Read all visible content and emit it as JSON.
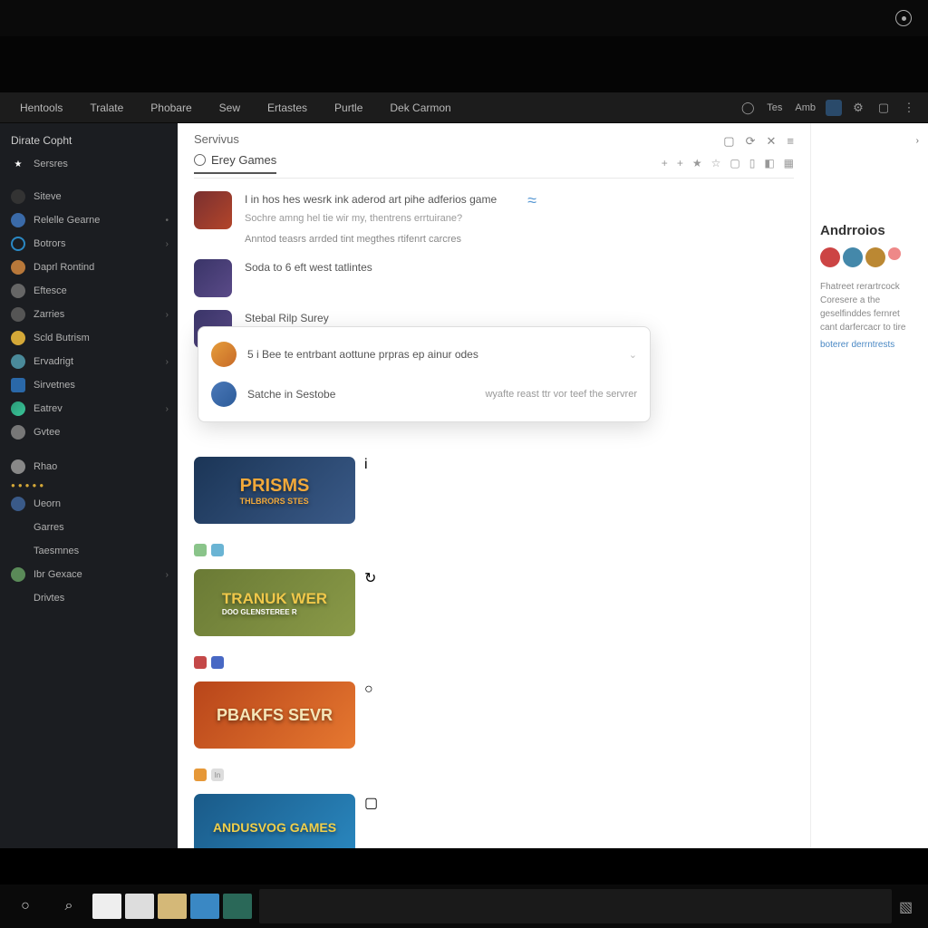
{
  "nav": {
    "items": [
      "Hentools",
      "Tralate",
      "Phobare",
      "Sew",
      "Ertastes",
      "Purtle",
      "Dek Carmon"
    ],
    "right": [
      "Tes",
      "Amb"
    ]
  },
  "sidebar": {
    "header": "Dirate Copht",
    "starred": "Sersres",
    "groups": [
      {
        "label": "Siteve",
        "sub": ""
      },
      {
        "label": "Relelle Gearne",
        "icon": "#3a6aa8"
      },
      {
        "label": "Botrors",
        "icon": "#2a88c4"
      },
      {
        "label": "Daprl Rontind",
        "icon": "#b8783a"
      },
      {
        "label": "Eftesce",
        "icon": "#666"
      },
      {
        "label": "Zarries",
        "icon": "#555"
      },
      {
        "label": "Scld Butrism",
        "icon": "#d4a838"
      },
      {
        "label": "Ervadrigt",
        "icon": "#4a8a9a"
      },
      {
        "label": "Sirvetnes",
        "icon": "#2a68a8"
      },
      {
        "label": "Eatrev",
        "icon": "#2a9a78"
      },
      {
        "label": "Gvtee",
        "icon": "#777"
      },
      {
        "label": "Rhao",
        "icon": "#888"
      }
    ],
    "lower": [
      {
        "label": "Ueorn",
        "icon": "#3a5a88"
      },
      {
        "label": "Garres",
        "icon": ""
      },
      {
        "label": "Taesmnes",
        "icon": ""
      },
      {
        "label": "Ibr Gexace",
        "icon": "#5a8a58"
      },
      {
        "label": "Drivtes",
        "icon": ""
      }
    ]
  },
  "content": {
    "crumb": "Servivus",
    "tab": "Erey Games",
    "feed": [
      {
        "title": "I in hos hes wesrk ink aderod art pihe adferios game",
        "sub": "Sochre amng hel tie wir my, thentrens errtuirane?",
        "line2": "Anntod teasrs arrded tint megthes rtifenrt carcres"
      },
      {
        "title": "Soda to 6 eft west tatlintes",
        "sub": ""
      },
      {
        "title": "Stebal Rilp Surey",
        "sub": ""
      }
    ],
    "popup": [
      {
        "text": "5 i Bee te entrbant aottune prpras ep ainur odes",
        "sub": ""
      },
      {
        "text": "Satche in Sestobe",
        "sub": "wyafte reast ttr vor teef the servrer"
      }
    ],
    "cards": [
      {
        "title": "PRISMS",
        "sub": "THLBRORS STES"
      },
      {
        "title": "TRANUK WER",
        "sub": "DOO GLENSTEREE R"
      },
      {
        "title": "PBAKFS SEVR",
        "sub": ""
      },
      {
        "title": "ANDUSVOG GAMES",
        "sub": ""
      }
    ]
  },
  "sidepanel": {
    "title": "Andrroios",
    "text": "Fhatreet rerartrcock Coresere a the geselfinddes fernret cant darfercacr to tire",
    "link": "boterer derrntrests"
  }
}
